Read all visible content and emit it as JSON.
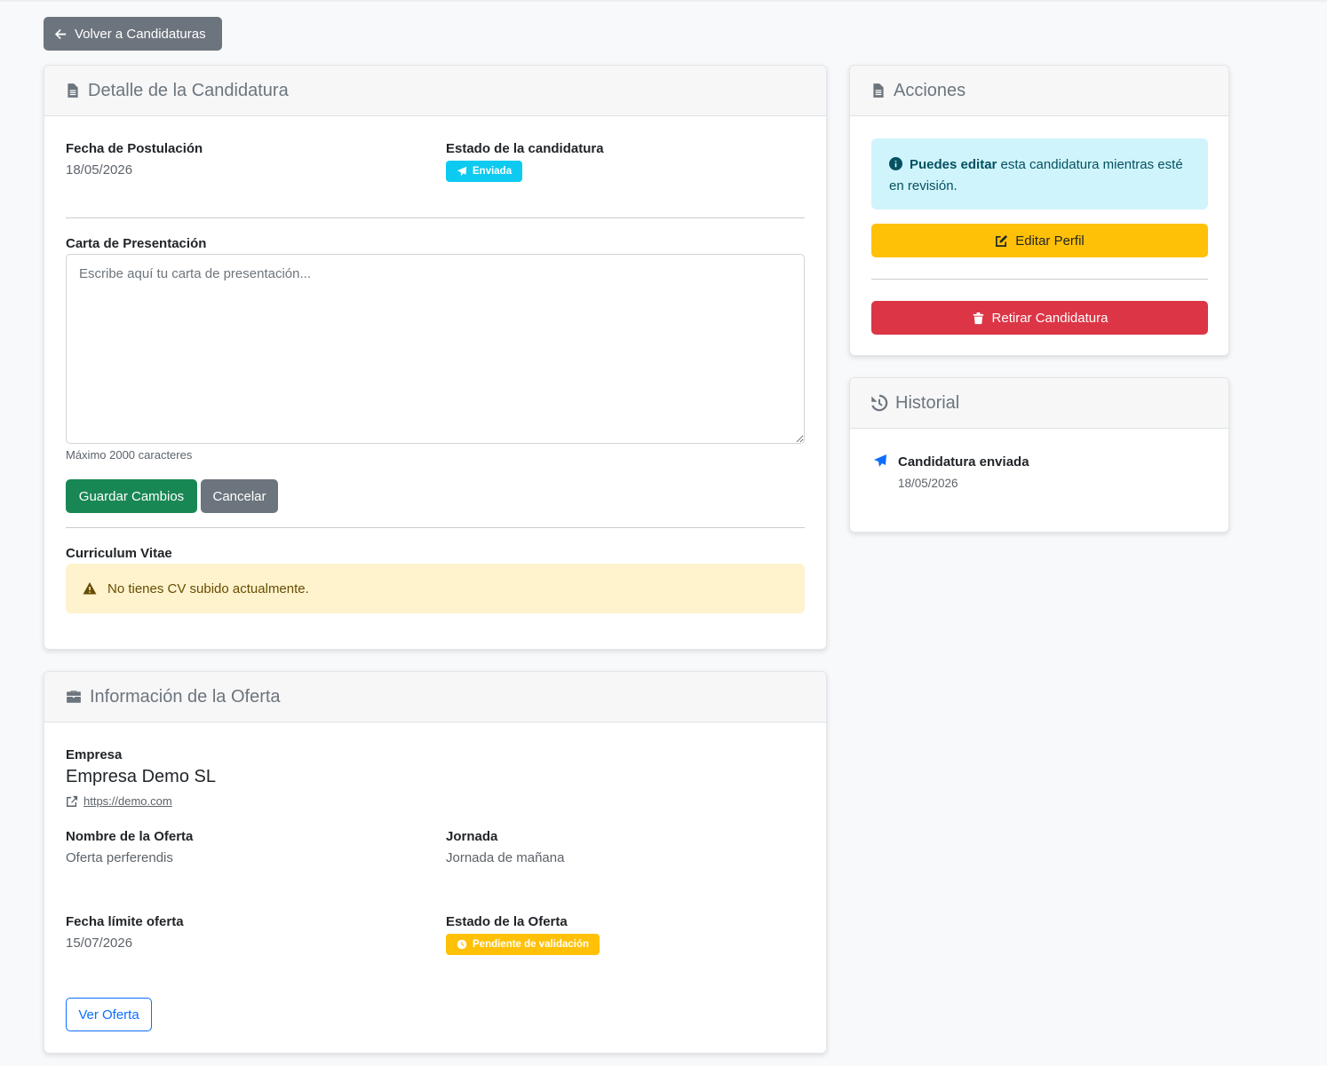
{
  "back_button": {
    "label": "Volver a Candidaturas"
  },
  "detail": {
    "title": "Detalle de la Candidatura",
    "fecha_label": "Fecha de Postulación",
    "fecha_value": "18/05/2026",
    "estado_label": "Estado de la candidatura",
    "estado_badge": "Enviada",
    "carta_label": "Carta de Presentación",
    "carta_placeholder": "Escribe aquí tu carta de presentación...",
    "carta_help": "Máximo 2000 caracteres",
    "save_button": "Guardar Cambios",
    "cancel_button": "Cancelar",
    "cv_label": "Curriculum Vitae",
    "cv_alert": "No tienes CV subido actualmente."
  },
  "offer": {
    "title": "Información de la Oferta",
    "empresa_label": "Empresa",
    "empresa_name": "Empresa Demo SL",
    "empresa_url": "https://demo.com",
    "nombre_label": "Nombre de la Oferta",
    "nombre_value": "Oferta perferendis",
    "jornada_label": "Jornada",
    "jornada_value": "Jornada de mañana",
    "fecha_limite_label": "Fecha límite oferta",
    "fecha_limite_value": "15/07/2026",
    "estado_label": "Estado de la Oferta",
    "estado_badge": "Pendiente de validación",
    "ver_button": "Ver Oferta"
  },
  "actions": {
    "title": "Acciones",
    "info_bold": "Puedes editar",
    "info_rest": " esta candidatura mientras esté en revisión.",
    "edit_button": "Editar Perfil",
    "withdraw_button": "Retirar Candidatura"
  },
  "history": {
    "title": "Historial",
    "items": [
      {
        "label": "Candidatura enviada",
        "date": "18/05/2026"
      }
    ]
  },
  "colors": {
    "secondary": "#6c757d",
    "info": "#0dcaf0",
    "warning": "#ffc107",
    "danger": "#dc3545",
    "success": "#198754",
    "primary": "#0d6efd"
  }
}
